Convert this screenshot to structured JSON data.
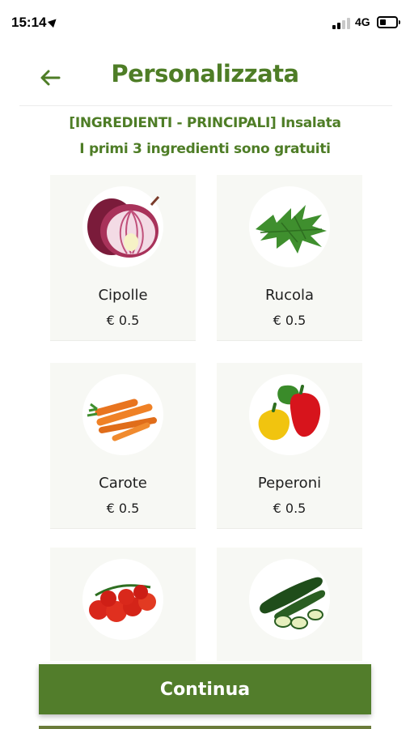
{
  "status_bar": {
    "time": "15:14",
    "network": "4G",
    "battery_level": 0.4,
    "signal_bars": 2
  },
  "header": {
    "title": "Personalizzata",
    "back_icon": "arrow-left-icon"
  },
  "subtitle": {
    "line1": "[INGREDIENTI - PRINCIPALI] Insalata",
    "line2": "I primi 3 ingredienti sono gratuiti"
  },
  "ingredients": [
    {
      "name": "Cipolle",
      "price": "€ 0.5",
      "icon": "onion-icon"
    },
    {
      "name": "Rucola",
      "price": "€ 0.5",
      "icon": "arugula-icon"
    },
    {
      "name": "Carote",
      "price": "€ 0.5",
      "icon": "carrot-icon"
    },
    {
      "name": "Peperoni",
      "price": "€ 0.5",
      "icon": "pepper-icon"
    },
    {
      "name": "",
      "price": "",
      "icon": "tomato-icon"
    },
    {
      "name": "",
      "price": "",
      "icon": "zucchini-icon"
    }
  ],
  "continue_label": "Continua",
  "colors": {
    "accent": "#4e7d26",
    "button": "#527d2b",
    "card_bg": "#f7f8f4"
  }
}
